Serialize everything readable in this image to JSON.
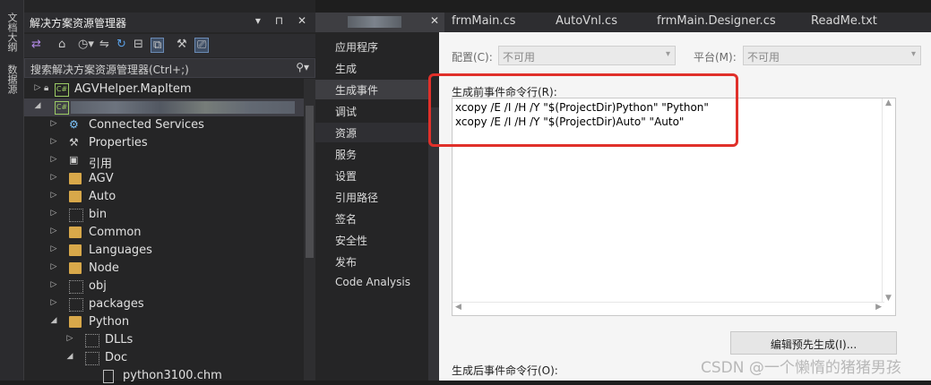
{
  "side_tabs": [
    "文档大纲",
    "数据源"
  ],
  "solution_explorer": {
    "title": "解决方案资源管理器",
    "title_buttons": "▾ ⊓ ✕",
    "search_placeholder": "搜索解决方案资源管理器(Ctrl+;)",
    "tree": [
      {
        "label": "AGVHelper.MapItem",
        "indent": 0,
        "arrow": "▷",
        "icon": "csharp-project-icon"
      },
      {
        "label": "",
        "indent": 0,
        "arrow": "◢",
        "icon": "csharp-project-icon"
      },
      {
        "label": "Connected Services",
        "indent": 1,
        "arrow": "▷",
        "icon": "connected-services-icon"
      },
      {
        "label": "Properties",
        "indent": 1,
        "arrow": "▷",
        "icon": "wrench-icon"
      },
      {
        "label": "引用",
        "indent": 1,
        "arrow": "▷",
        "icon": "references-icon"
      },
      {
        "label": "AGV",
        "indent": 1,
        "arrow": "▷",
        "icon": "folder-icon"
      },
      {
        "label": "Auto",
        "indent": 1,
        "arrow": "▷",
        "icon": "folder-icon"
      },
      {
        "label": "bin",
        "indent": 1,
        "arrow": "▷",
        "icon": "folder-dotted-icon"
      },
      {
        "label": "Common",
        "indent": 1,
        "arrow": "▷",
        "icon": "folder-icon"
      },
      {
        "label": "Languages",
        "indent": 1,
        "arrow": "▷",
        "icon": "folder-icon"
      },
      {
        "label": "Node",
        "indent": 1,
        "arrow": "▷",
        "icon": "folder-icon"
      },
      {
        "label": "obj",
        "indent": 1,
        "arrow": "▷",
        "icon": "folder-dotted-icon"
      },
      {
        "label": "packages",
        "indent": 1,
        "arrow": "▷",
        "icon": "folder-dotted-icon"
      },
      {
        "label": "Python",
        "indent": 1,
        "arrow": "◢",
        "icon": "folder-icon"
      },
      {
        "label": "DLLs",
        "indent": 2,
        "arrow": "▷",
        "icon": "folder-dotted-icon"
      },
      {
        "label": "Doc",
        "indent": 2,
        "arrow": "◢",
        "icon": "folder-dotted-icon"
      },
      {
        "label": "python3100.chm",
        "indent": 3,
        "arrow": "",
        "icon": "file-icon"
      }
    ]
  },
  "tabs": [
    {
      "label": "",
      "close": "✕"
    },
    {
      "label": "frmMain.cs"
    },
    {
      "label": "AutoVnl.cs"
    },
    {
      "label": "frmMain.Designer.cs"
    },
    {
      "label": "ReadMe.txt"
    }
  ],
  "nav": [
    "应用程序",
    "生成",
    "生成事件",
    "调试",
    "资源",
    "服务",
    "设置",
    "引用路径",
    "签名",
    "安全性",
    "发布",
    "Code Analysis"
  ],
  "nav_selected": "生成事件",
  "config": {
    "label": "配置(C):",
    "value": "不可用"
  },
  "platform": {
    "label": "平台(M):",
    "value": "不可用"
  },
  "pre_build": {
    "label": "生成前事件命令行(R):",
    "lines": [
      "xcopy /E /I /H /Y \"$(ProjectDir)Python\" \"Python\"",
      "xcopy /E /I /H /Y \"$(ProjectDir)Auto\" \"Auto\""
    ]
  },
  "edit_pre_build_button": "编辑预先生成(I)...",
  "post_build_label": "生成后事件命令行(O):",
  "watermark": "CSDN @一个懒惰的猪猪男孩"
}
